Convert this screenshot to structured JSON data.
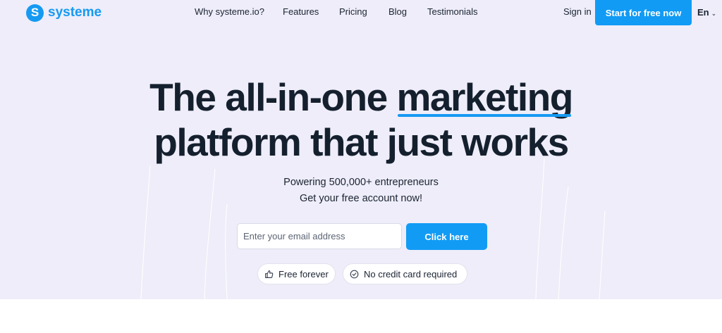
{
  "brand": {
    "name": "systeme",
    "mark": "S",
    "color": "#159af2"
  },
  "nav": {
    "items": [
      {
        "label": "Why systeme.io?"
      },
      {
        "label": "Features"
      },
      {
        "label": "Pricing"
      },
      {
        "label": "Blog"
      },
      {
        "label": "Testimonials"
      }
    ],
    "sign_in": "Sign in",
    "cta": "Start for free now",
    "language": "En"
  },
  "hero": {
    "line1_before": "The all-in-one ",
    "line1_highlight": "marketing",
    "line2": "platform that just works",
    "sub1": "Powering 500,000+ entrepreneurs",
    "sub2": "Get your free account now!"
  },
  "signup": {
    "email_placeholder": "Enter your email address",
    "email_value": "",
    "button": "Click here"
  },
  "badges": [
    {
      "label": "Free forever",
      "icon": "thumbs-up-icon"
    },
    {
      "label": "No credit card required",
      "icon": "check-circle-icon"
    }
  ],
  "colors": {
    "accent": "#119bf5",
    "hero_bg": "#eeedf9",
    "text": "#15202e"
  }
}
